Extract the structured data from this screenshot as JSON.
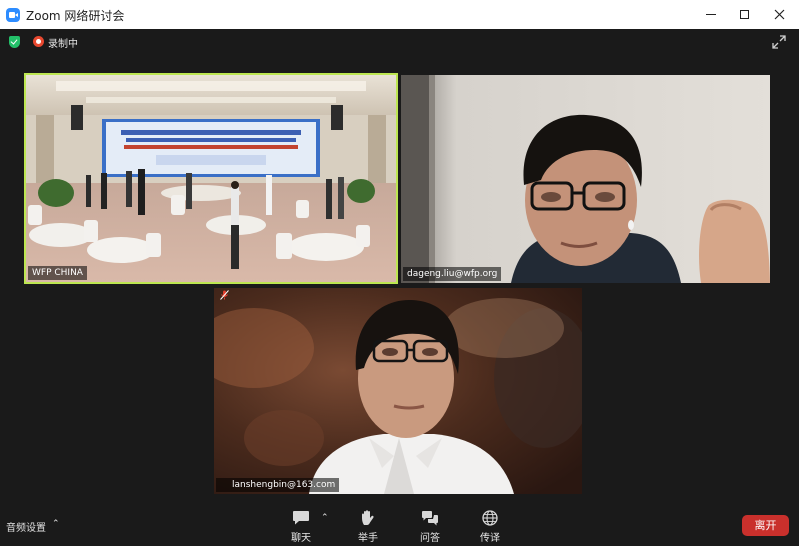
{
  "window": {
    "title": "Zoom 网络研讨会",
    "minimize_icon": "minimize-icon",
    "maximize_icon": "maximize-icon",
    "close_icon": "close-icon"
  },
  "topbar": {
    "security_icon": "shield-check-icon",
    "recording_label": "录制中",
    "fullscreen_icon": "fullscreen-icon"
  },
  "videos": [
    {
      "name": "WFP CHINA",
      "active_speaker": true,
      "muted": false,
      "highlight_color": "#bde651"
    },
    {
      "name": "dageng.liu@wfp.org",
      "active_speaker": false,
      "muted": false
    },
    {
      "name": "lanshengbin@163.com",
      "active_speaker": false,
      "muted": true
    }
  ],
  "toolbar": {
    "audio_settings": "音频设置",
    "chat": "聊天",
    "raise_hand": "举手",
    "qa": "问答",
    "interpretation": "传译",
    "leave": "离开"
  },
  "colors": {
    "background": "#1a1a1a",
    "leave_button": "#c9302c",
    "security_green": "#23c069",
    "recording_red": "#e8482f"
  }
}
